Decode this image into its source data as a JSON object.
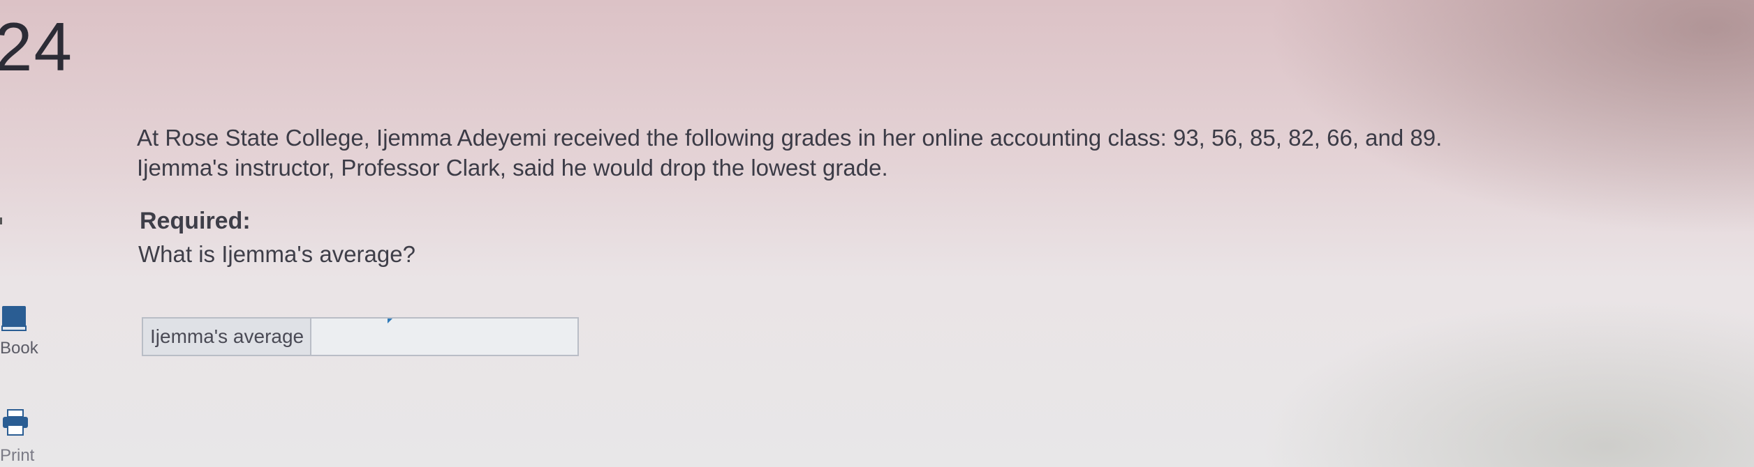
{
  "question": {
    "number": "24",
    "problem_line1": "At Rose State College, Ijemma Adeyemi received the following grades in her online accounting class: 93, 56, 85, 82, 66, and 89.",
    "problem_line2": "Ijemma's instructor, Professor Clark, said he would drop the lowest grade.",
    "required_heading": "Required:",
    "required_question": "What is Ijemma's average?"
  },
  "answer": {
    "label": "Ijemma's average",
    "value": ""
  },
  "tools": {
    "book_label": "Book",
    "print_label": "Print"
  },
  "colors": {
    "accent_marker": "#2f79b8",
    "icon_blue": "#2a5d93"
  }
}
